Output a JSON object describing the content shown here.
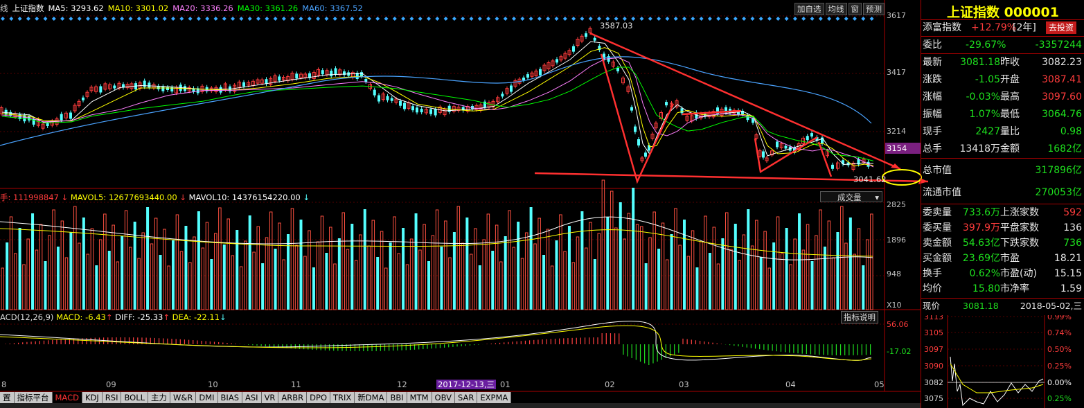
{
  "header": {
    "period": "线",
    "name": "上证指数",
    "ma5": "MA5: 3293.62",
    "ma10": "MA10: 3301.02",
    "ma20": "MA20: 3336.26",
    "ma30": "MA30: 3361.26",
    "ma60": "MA60: 3367.52",
    "buttons": [
      "加自选",
      "均线",
      "窗",
      "预测"
    ]
  },
  "price_axis": [
    "3617",
    "3417",
    "3214",
    "3154"
  ],
  "price_labels": {
    "high": "3587.03",
    "low": "3041.62"
  },
  "volume_header": {
    "vol": "手: 111998847",
    "mavol5": "MAVOL5: 12677693440.00",
    "mavol10": "MAVOL10: 14376154220.00",
    "selector": "成交量"
  },
  "volume_axis": [
    "2825",
    "1896",
    "948",
    "X10"
  ],
  "macd_header": {
    "title": "ACD(12,26,9)",
    "macd": "MACD: -6.43",
    "diff": "DIFF: -25.33",
    "dea": "DEA: -22.11",
    "help": "指标说明"
  },
  "macd_axis": [
    "56.06",
    "-17.02"
  ],
  "months": [
    "8",
    "09",
    "10",
    "11",
    "12",
    "01",
    "02",
    "03",
    "04",
    "05"
  ],
  "date_marker": "2017-12-13,三",
  "tabs": [
    "置",
    "指标平台",
    "MACD",
    "KDJ",
    "RSI",
    "BOLL",
    "主力",
    "W&R",
    "DMI",
    "BIAS",
    "ASI",
    "VR",
    "ARBR",
    "DPO",
    "TRIX",
    "新DMA",
    "BBI",
    "MTM",
    "OBV",
    "SAR",
    "EXPMA"
  ],
  "active_tab": "MACD",
  "panel": {
    "title": "上证指数 000001",
    "tianfu_label": "添富指数",
    "tianfu_value": "+12.79%",
    "tianfu_period": "[2年]",
    "invest_button": "去投资",
    "weibi_label": "委比",
    "weibi_pct": "-29.67%",
    "weibi_val": "-3357244",
    "rows": [
      {
        "l1": "最新",
        "v1": "3081.18",
        "c1": "grn",
        "l2": "昨收",
        "v2": "3082.23",
        "c2": "wht"
      },
      {
        "l1": "涨跌",
        "v1": "-1.05",
        "c1": "grn",
        "l2": "开盘",
        "v2": "3087.41",
        "c2": "red"
      },
      {
        "l1": "涨幅",
        "v1": "-0.03%",
        "c1": "grn",
        "l2": "最高",
        "v2": "3097.60",
        "c2": "red"
      },
      {
        "l1": "振幅",
        "v1": "1.07%",
        "c1": "grn",
        "l2": "最低",
        "v2": "3064.76",
        "c2": "grn"
      },
      {
        "l1": "现手",
        "v1": "2427",
        "c1": "grn",
        "l2": "量比",
        "v2": "0.98",
        "c2": "grn"
      },
      {
        "l1": "总手",
        "v1": "13418万",
        "c1": "wht",
        "l2": "金额",
        "v2": "1682亿",
        "c2": "grn"
      }
    ],
    "total_mv_label": "总市值",
    "total_mv_value": "317896亿",
    "float_mv_label": "流通市值",
    "float_mv_value": "270053亿",
    "rows2": [
      {
        "l1": "委卖量",
        "v1": "733.6万",
        "c1": "grn",
        "l2": "上涨家数",
        "v2": "592",
        "c2": "red"
      },
      {
        "l1": "委买量",
        "v1": "397.9万",
        "c1": "red",
        "l2": "平盘家数",
        "v2": "136",
        "c2": "wht"
      },
      {
        "l1": "卖金额",
        "v1": "54.63亿",
        "c1": "grn",
        "l2": "下跌家数",
        "v2": "736",
        "c2": "grn"
      },
      {
        "l1": "买金额",
        "v1": "23.69亿",
        "c1": "grn",
        "l2": "市盈",
        "v2": "18.21",
        "c2": "wht"
      },
      {
        "l1": "换手",
        "v1": "0.62%",
        "c1": "grn",
        "l2": "市盈(动)",
        "v2": "15.15",
        "c2": "wht"
      },
      {
        "l1": "均价",
        "v1": "15.80",
        "c1": "grn",
        "l2": "市净率",
        "v2": "1.59",
        "c2": "wht"
      }
    ],
    "current_label": "现价",
    "current_value": "3081.18",
    "current_date": "2018-05-02,三",
    "mini_left": [
      "3113",
      "3105",
      "3097",
      "3090",
      "3082",
      "3075"
    ],
    "mini_right": [
      "0.99%",
      "0.74%",
      "0.50%",
      "0.25%",
      "0.00%",
      "0.25%"
    ]
  },
  "colors": {
    "up": "#ff3c3c",
    "down": "#54ffff",
    "ma5": "#ffffff",
    "ma10": "#ffff00",
    "ma20": "#ff80ff",
    "ma30": "#00ff00",
    "ma60": "#4aa3ff"
  }
}
